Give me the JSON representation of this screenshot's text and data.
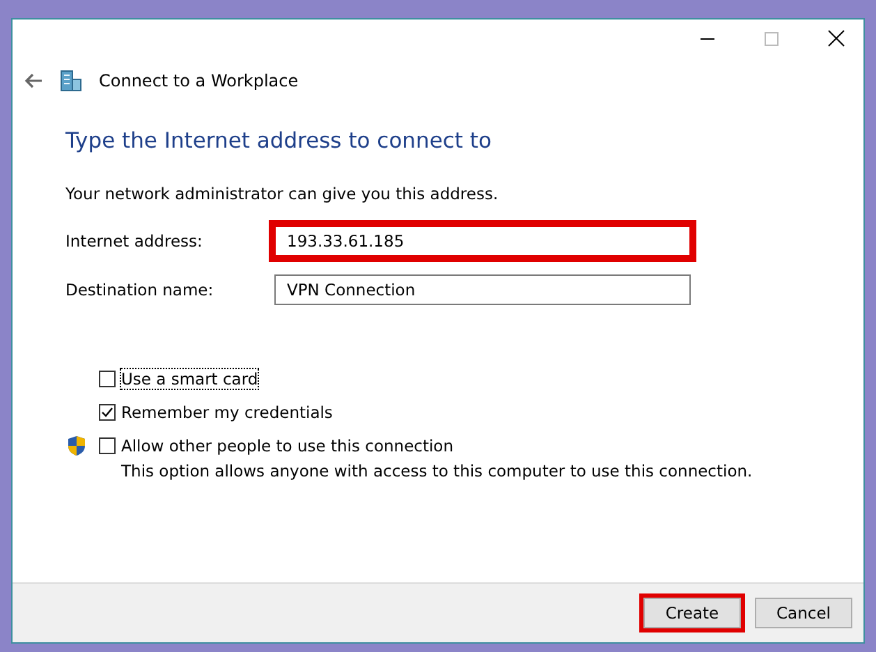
{
  "window": {
    "title": "Connect to a Workplace"
  },
  "heading": "Type the Internet address to connect to",
  "intro": "Your network administrator can give you this address.",
  "fields": [
    {
      "label": "Internet address:",
      "value": "193.33.61.185",
      "highlighted": true
    },
    {
      "label": "Destination name:",
      "value": "VPN Connection",
      "highlighted": false
    }
  ],
  "options": [
    {
      "label": "Use a smart card",
      "checked": false,
      "focused": true,
      "shield": false
    },
    {
      "label": "Remember my credentials",
      "checked": true,
      "focused": false,
      "shield": false
    },
    {
      "label": "Allow other people to use this connection",
      "checked": false,
      "focused": false,
      "shield": true,
      "note": "This option allows anyone with access to this computer to use this connection."
    }
  ],
  "buttons": [
    {
      "label": "Create",
      "highlighted": true
    },
    {
      "label": "Cancel",
      "highlighted": false
    }
  ]
}
